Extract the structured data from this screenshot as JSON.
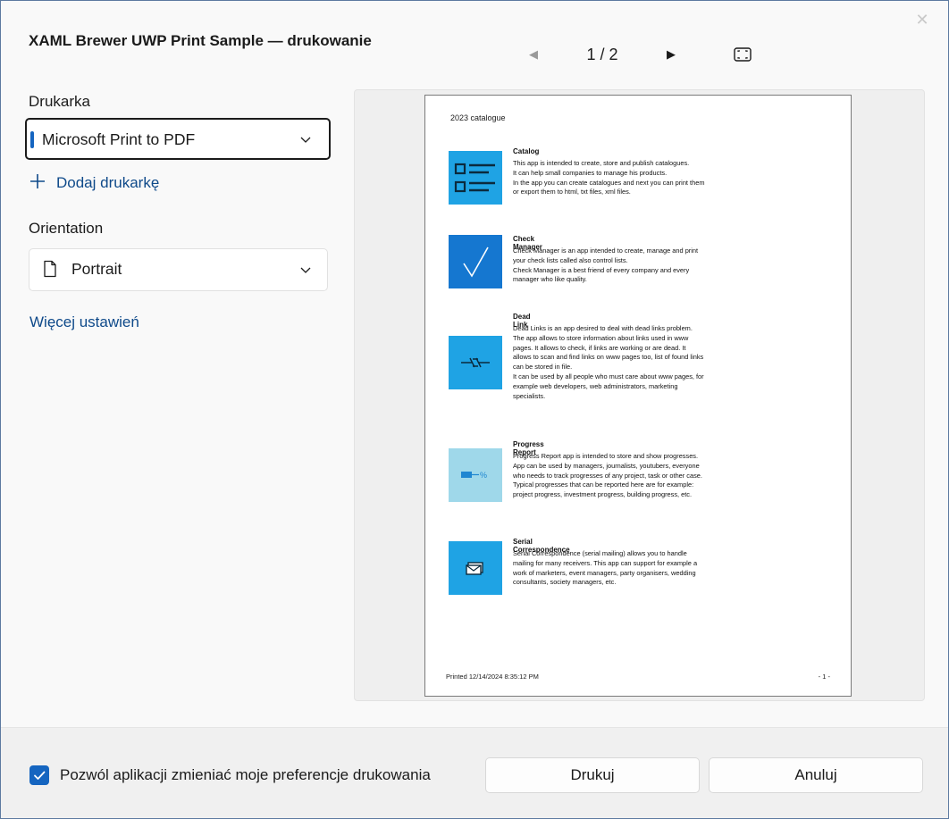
{
  "dialog": {
    "title": "XAML Brewer UWP Print Sample — drukowanie",
    "close_icon": "close-icon"
  },
  "pager": {
    "prev_icon": "◀",
    "page_text": "1 / 2",
    "next_icon": "▶",
    "fit_icon": "fit-to-window-icon"
  },
  "settings": {
    "printer_label": "Drukarka",
    "printer_value": "Microsoft Print to PDF",
    "add_printer_label": "Dodaj drukarkę",
    "orientation_label": "Orientation",
    "orientation_value": "Portrait",
    "more_settings_label": "Więcej ustawień"
  },
  "preview": {
    "header": "2023 catalogue",
    "entries": [
      {
        "title": "Catalog",
        "icon": "catalog-list-icon",
        "color": "#1fa3e4",
        "text": "This app is intended to create, store and publish catalogues.\nIt can help small companies to manage his products.\nIn the app you can create catalogues and next you can print them or export them to html, txt files, xml files."
      },
      {
        "title": "Check Manager",
        "icon": "checkmark-icon",
        "color": "#1577d0",
        "text": "Check Manager is an app intended to create, manage and print your check lists called also control lists.\nCheck Manager is a best friend of every company and every manager who like quality."
      },
      {
        "title": "Dead Link",
        "icon": "broken-link-icon",
        "color": "#1fa3e4",
        "text": "Dead Links is an app desired to deal with dead links problem.\nThe app allows to store information about links used in www pages. It allows to check, if links are working or are dead. It allows to scan and find links on www pages too, list of found links can be stored in file.\nIt can be used by all people who must care about www pages, for example web developers, web administrators, marketing specialists."
      },
      {
        "title": "Progress Report",
        "icon": "progress-bar-icon",
        "color": "#9fd8ea",
        "text": "Progress Report app is intended to store and show progresses. App can be used by managers, journalists, youtubers, everyone who needs to track progresses of any project, task or other case. Typical progresses that can be reported here are for example: project progress, investment progress, building progress, etc."
      },
      {
        "title": "Serial Correspondence",
        "icon": "envelopes-icon",
        "color": "#1fa3e4",
        "text": "Serial Correspondence (serial mailing) allows you to handle mailing for many receivers. This app can support for example a work of marketers, event managers, party organisers, wedding consultants, society managers, etc."
      }
    ],
    "footer_left": "Printed 12/14/2024 8:35:12 PM",
    "footer_right": "- 1 -"
  },
  "footer": {
    "checkbox_label": "Pozwól aplikacji zmieniać moje preferencje drukowania",
    "checkbox_checked": true,
    "print_label": "Drukuj",
    "cancel_label": "Anuluj"
  }
}
